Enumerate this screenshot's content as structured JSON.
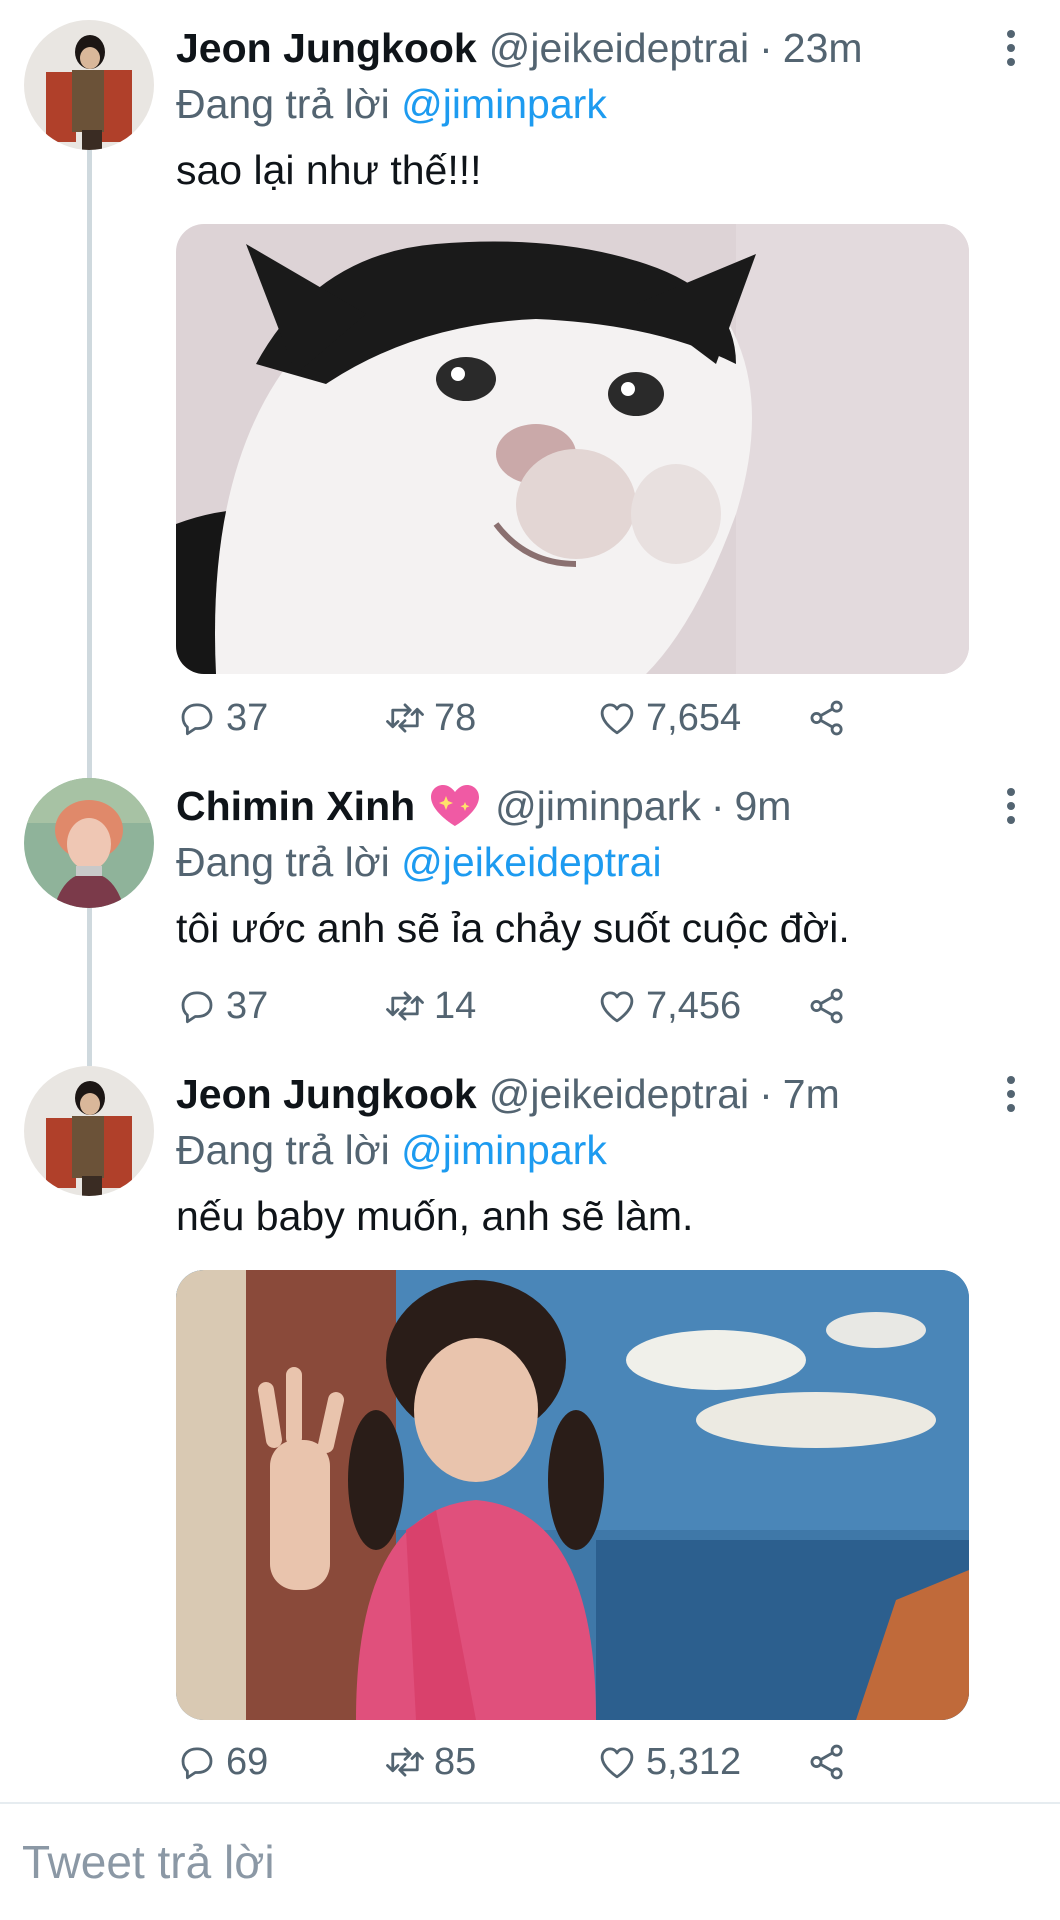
{
  "thread": [
    {
      "author_name": "Jeon Jungkook",
      "author_handle": "@jeikeideptrai",
      "separator": "·",
      "time": "23m",
      "reply_prefix": "Đang trả lời",
      "reply_to": "@jiminpark",
      "text": "sao lại như thế!!!",
      "media": "crying-cat-photo",
      "stats": {
        "replies": "37",
        "retweets": "78",
        "likes": "7,654"
      }
    },
    {
      "author_name": "Chimin Xinh",
      "author_emoji": "sparkling-heart",
      "author_handle": "@jiminpark",
      "separator": "·",
      "time": "9m",
      "reply_prefix": "Đang trả lời",
      "reply_to": "@jeikeideptrai",
      "text": "tôi ước anh sẽ ỉa chảy suốt cuộc đời.",
      "stats": {
        "replies": "37",
        "retweets": "14",
        "likes": "7,456"
      }
    },
    {
      "author_name": "Jeon Jungkook",
      "author_handle": "@jeikeideptrai",
      "separator": "·",
      "time": "7m",
      "reply_prefix": "Đang trả lời",
      "reply_to": "@jiminpark",
      "text": "nếu baby muốn, anh sẽ làm.",
      "media": "child-pink-jacket-photo",
      "stats": {
        "replies": "69",
        "retweets": "85",
        "likes": "5,312"
      }
    }
  ],
  "composer": {
    "placeholder": "Tweet trả lời"
  },
  "icons": [
    "reply-icon",
    "retweet-icon",
    "like-icon",
    "share-icon",
    "more-options-icon"
  ],
  "colors": {
    "link": "#1d9bf0",
    "secondary_text": "#536471",
    "thread_line": "#cfd9de"
  }
}
